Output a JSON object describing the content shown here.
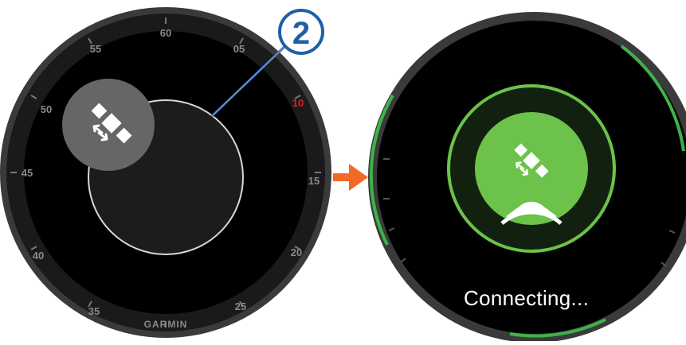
{
  "bezel_labels": {
    "top": "60",
    "upper_left": "55",
    "upper_right": "05",
    "left_upper": "50",
    "right_marker": "10",
    "left": "45",
    "right": "15",
    "left_lower": "40",
    "right_lower": "20",
    "lower_left": "35",
    "lower_right": "25"
  },
  "brand": "GARMIN",
  "callout_number": "2",
  "status_text": "Connecting...",
  "colors": {
    "watch_face": "#000000",
    "bezel": "#3a3a3a",
    "accent_green": "#6cc24a",
    "ring_green": "#3fb24a",
    "arrow": "#f06a24",
    "callout_blue": "#1f5fa8",
    "marker_red": "#d82020"
  },
  "icons": [
    "satellite-icon",
    "signal-waves-icon",
    "arrow-right-icon",
    "callout-badge"
  ]
}
